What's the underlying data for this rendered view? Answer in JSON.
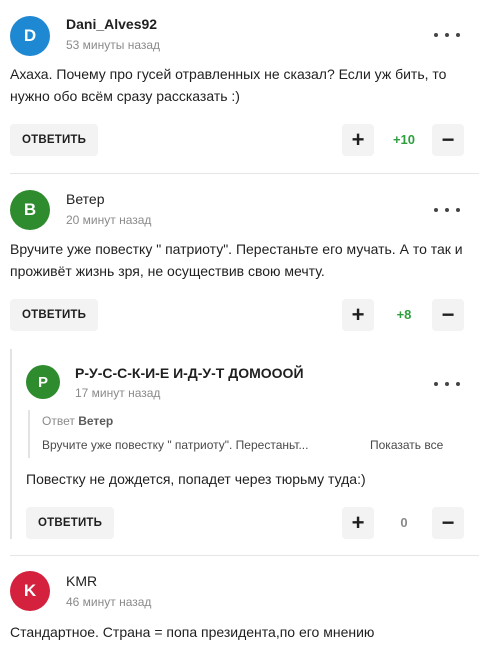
{
  "comments": [
    {
      "avatar_letter": "D",
      "avatar_color": "#1e88d3",
      "author": "Dani_Alves92",
      "time": "53 минуты назад",
      "text": "Ахаха. Почему про гусей отравленных не сказал? Если уж бить, то нужно обо всём сразу рассказать :)",
      "reply_label": "ОТВЕТИТЬ",
      "score": "+10",
      "score_color": "#2e9e3e"
    },
    {
      "avatar_letter": "B",
      "avatar_color": "#2e8b2e",
      "author": "Ветер",
      "time": "20 минут назад",
      "text": "Вручите уже повестку \" патриоту\". Перестаньте его мучать. А то так и проживёт жизнь зря, не осуществив свою мечту.",
      "reply_label": "ОТВЕТИТЬ",
      "score": "+8",
      "score_color": "#2e9e3e"
    },
    {
      "avatar_letter": "P",
      "avatar_color": "#2e8b2e",
      "author": "Р-У-С-С-К-И-Е И-Д-У-Т ДОМОООЙ",
      "time": "17 минут назад",
      "quote_prefix": "Ответ",
      "quote_author": "Ветер",
      "quote_text": "Вручите уже повестку \" патриоту\". Перестаньт...",
      "show_all": "Показать все",
      "text": "Повестку не дождется, попадет через тюрьму туда:)",
      "reply_label": "ОТВЕТИТЬ",
      "score": "0",
      "score_color": "#8a8a8a"
    },
    {
      "avatar_letter": "K",
      "avatar_color": "#d4213d",
      "author": "KMR",
      "time": "46 минут назад",
      "text": "Стандартное. Страна = попа президента,по его мнению"
    }
  ],
  "icons": {
    "upvote": "+",
    "downvote": "−",
    "menu": "more-dots-icon"
  }
}
